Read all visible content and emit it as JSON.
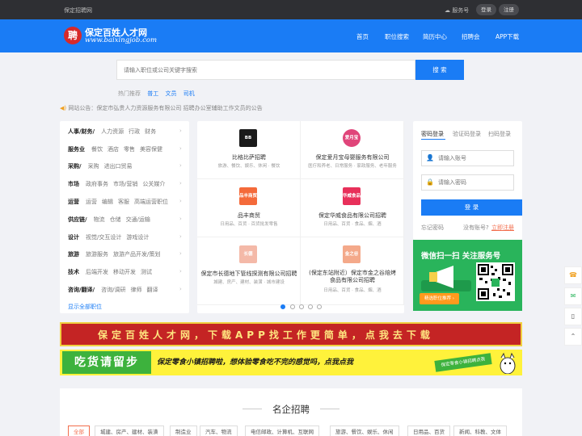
{
  "topbar": {
    "site_name": "保定招聘网",
    "service": "服务号",
    "login": "登录",
    "register": "注册"
  },
  "header": {
    "logo_char": "聘",
    "logo_title": "保定百姓人才网",
    "logo_sub": "www.baixingjob.com"
  },
  "nav": [
    "首页",
    "职位搜索",
    "简历中心",
    "招聘会",
    "APP下载"
  ],
  "search": {
    "placeholder": "请输入职位或公司关键字搜索",
    "button": "搜 索"
  },
  "hot": {
    "label": "热门推荐",
    "keywords": [
      "普工",
      "文员",
      "司机"
    ]
  },
  "notice": "网站公告：保定市弘贵人力资源服务有限公司 招聘办公室辅助工作文员的公告",
  "categories": [
    {
      "head": "人事/财务/",
      "subs": [
        "人力资源",
        "行政",
        "财务"
      ]
    },
    {
      "head": "服务业",
      "subs": [
        "餐饮",
        "酒店",
        "零售",
        "美容保健"
      ]
    },
    {
      "head": "采购/",
      "subs": [
        "采购",
        "进出口贸易"
      ]
    },
    {
      "head": "市场",
      "subs": [
        "政府事务",
        "市场/营销",
        "公关媒介"
      ]
    },
    {
      "head": "运营",
      "subs": [
        "运营",
        "编辑",
        "客服",
        "高端运营职位"
      ]
    },
    {
      "head": "供应链/",
      "subs": [
        "物流",
        "仓储",
        "交通/运输"
      ]
    },
    {
      "head": "设计",
      "subs": [
        "视觉/交互设计",
        "游戏设计"
      ]
    },
    {
      "head": "旅游",
      "subs": [
        "旅游服务",
        "旅游产品开发/策划"
      ]
    },
    {
      "head": "技术",
      "subs": [
        "后端开发",
        "移动开发",
        "测试"
      ]
    },
    {
      "head": "咨询/翻译/",
      "subs": [
        "咨询/调研",
        "律师",
        "翻译"
      ]
    }
  ],
  "show_all": "显示全部职位",
  "companies": [
    {
      "logo": "BB PIZZA",
      "name": "比格比萨招聘",
      "tags": "旅游、餐饮、娱乐、休闲 · 餐饮",
      "color": "#1a1a1a"
    },
    {
      "logo": "爱月宝",
      "name": "保定爱月宝母婴服务有限公司",
      "tags": "医疗和养老、日常服务 · 家政服务、老年服务",
      "color": "#e0457a"
    },
    {
      "logo": "品丰商贸",
      "name": "品丰商贸",
      "tags": "日用品、百货 · 百货批发零售",
      "color": "#f46a3a"
    },
    {
      "logo": "华威食品",
      "name": "保定华威食品有限公司招聘",
      "tags": "日用品、百货 · 食品、烟、酒",
      "color": "#e8305a"
    },
    {
      "logo": "长德",
      "name": "保定市长德地下管线探测有限公司招聘",
      "tags": "城建、房产、建材、装潢 · 城市建设",
      "color": "#f4b9a8"
    },
    {
      "logo": "金之谷",
      "name": "(保定东站附近）保定市金之谷焙烤食品有限公司招聘",
      "tags": "日用品、百货 · 食品、烟、酒",
      "color": "#f4a98a"
    }
  ],
  "login": {
    "tabs": [
      "密码登录",
      "验证码登录",
      "扫码登录"
    ],
    "account_placeholder": "请输入账号",
    "password_placeholder": "请输入密码",
    "button": "登 录",
    "forgot": "忘记密码",
    "no_account": "没有账号?",
    "register_now": "立即注册"
  },
  "wechat": {
    "title": "微信扫一扫 关注服务号",
    "button": "精选职位推荐 ›"
  },
  "banner1": "保定百姓人才网，下载APP找工作更简单，点我去下载",
  "banner2": {
    "left": "吃货请留步",
    "middle": "保定零食小镇招聘啦，想体验零食吃不完的感觉吗，点我点我",
    "right": "保定零食小镇招聘点我"
  },
  "famous": {
    "title": "名企招聘",
    "filters": [
      "全部",
      "城建、房产、建材、装潢",
      "制造业",
      "汽车、物流",
      "电信邮政、计算机、互联网",
      "旅游、餐饮、娱乐、休闲",
      "日用品、百货",
      "新闻、科教、文体"
    ]
  },
  "colors": {
    "primary": "#1a7cf5",
    "wechat": "#29b45b",
    "accent": "#f26d4c"
  }
}
